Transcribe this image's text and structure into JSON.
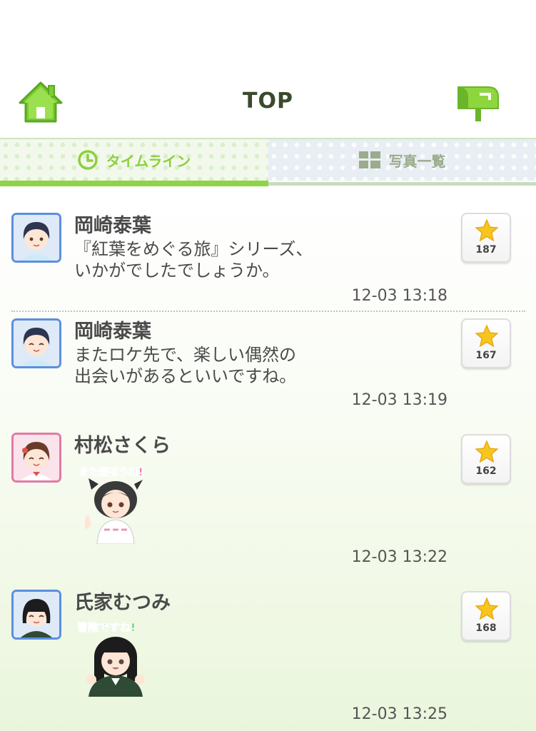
{
  "header": {
    "title": "TOP",
    "home_icon": "home-icon",
    "mail_icon": "mailbox-icon"
  },
  "tabs": [
    {
      "label": "タイムライン",
      "icon": "clock-icon",
      "active": true
    },
    {
      "label": "写真一覧",
      "icon": "grid-icon",
      "active": false
    }
  ],
  "colors": {
    "accent_green": "#8fd346",
    "title_text": "#3a4a2c",
    "star_yellow": "#f7c51e"
  },
  "posts": [
    {
      "name": "岡崎泰葉",
      "message_lines": [
        "『紅葉をめぐる旅』シリーズ、",
        "いかがでしたでしょうか。"
      ],
      "time": "12-03 13:18",
      "likes": "187",
      "avatar_icon": "avatar-okazaki-yasuha"
    },
    {
      "name": "岡崎泰葉",
      "message_lines": [
        "またロケ先で、楽しい偶然の",
        "出会いがあるといいですね。"
      ],
      "time": "12-03 13:19",
      "likes": "167",
      "avatar_icon": "avatar-okazaki-yasuha"
    },
    {
      "name": "村松さくら",
      "sticker_text": "また遊ぼうね!",
      "time": "12-03 13:22",
      "likes": "162",
      "avatar_icon": "avatar-muramatsu-sakura"
    },
    {
      "name": "氏家むつみ",
      "sticker_text": "冒険ですね!",
      "time": "12-03 13:25",
      "likes": "168",
      "avatar_icon": "avatar-ujiie-mutsumi"
    }
  ]
}
